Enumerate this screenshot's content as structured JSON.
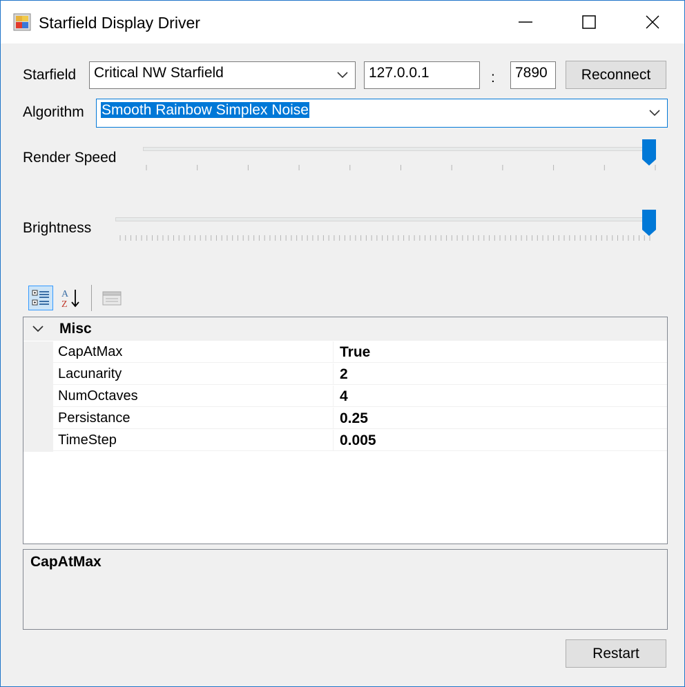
{
  "window": {
    "title": "Starfield Display Driver"
  },
  "connection": {
    "starfield_label": "Starfield",
    "starfield_value": "Critical NW Starfield",
    "host": "127.0.0.1",
    "separator": ":",
    "port": "7890",
    "reconnect_label": "Reconnect"
  },
  "algorithm": {
    "label": "Algorithm",
    "value": "Smooth Rainbow Simplex Noise"
  },
  "sliders": {
    "render_speed": {
      "label": "Render Speed",
      "value_fraction": 1.0,
      "tick_count": 11
    },
    "brightness": {
      "label": "Brightness",
      "value_fraction": 1.0,
      "tick_count": 100
    }
  },
  "toolbar": {
    "categorized": "categorized-icon",
    "alphabetical": "sort-az-icon",
    "property_pages": "property-pages-icon"
  },
  "property_grid": {
    "category": "Misc",
    "properties": [
      {
        "name": "CapAtMax",
        "value": "True"
      },
      {
        "name": "Lacunarity",
        "value": "2"
      },
      {
        "name": "NumOctaves",
        "value": "4"
      },
      {
        "name": "Persistance",
        "value": "0.25"
      },
      {
        "name": "TimeStep",
        "value": "0.005"
      }
    ]
  },
  "help": {
    "title": "CapAtMax"
  },
  "footer": {
    "restart_label": "Restart"
  },
  "colors": {
    "accent": "#0078d7",
    "selection": "#0078d7",
    "window_border": "#1e74c8"
  }
}
